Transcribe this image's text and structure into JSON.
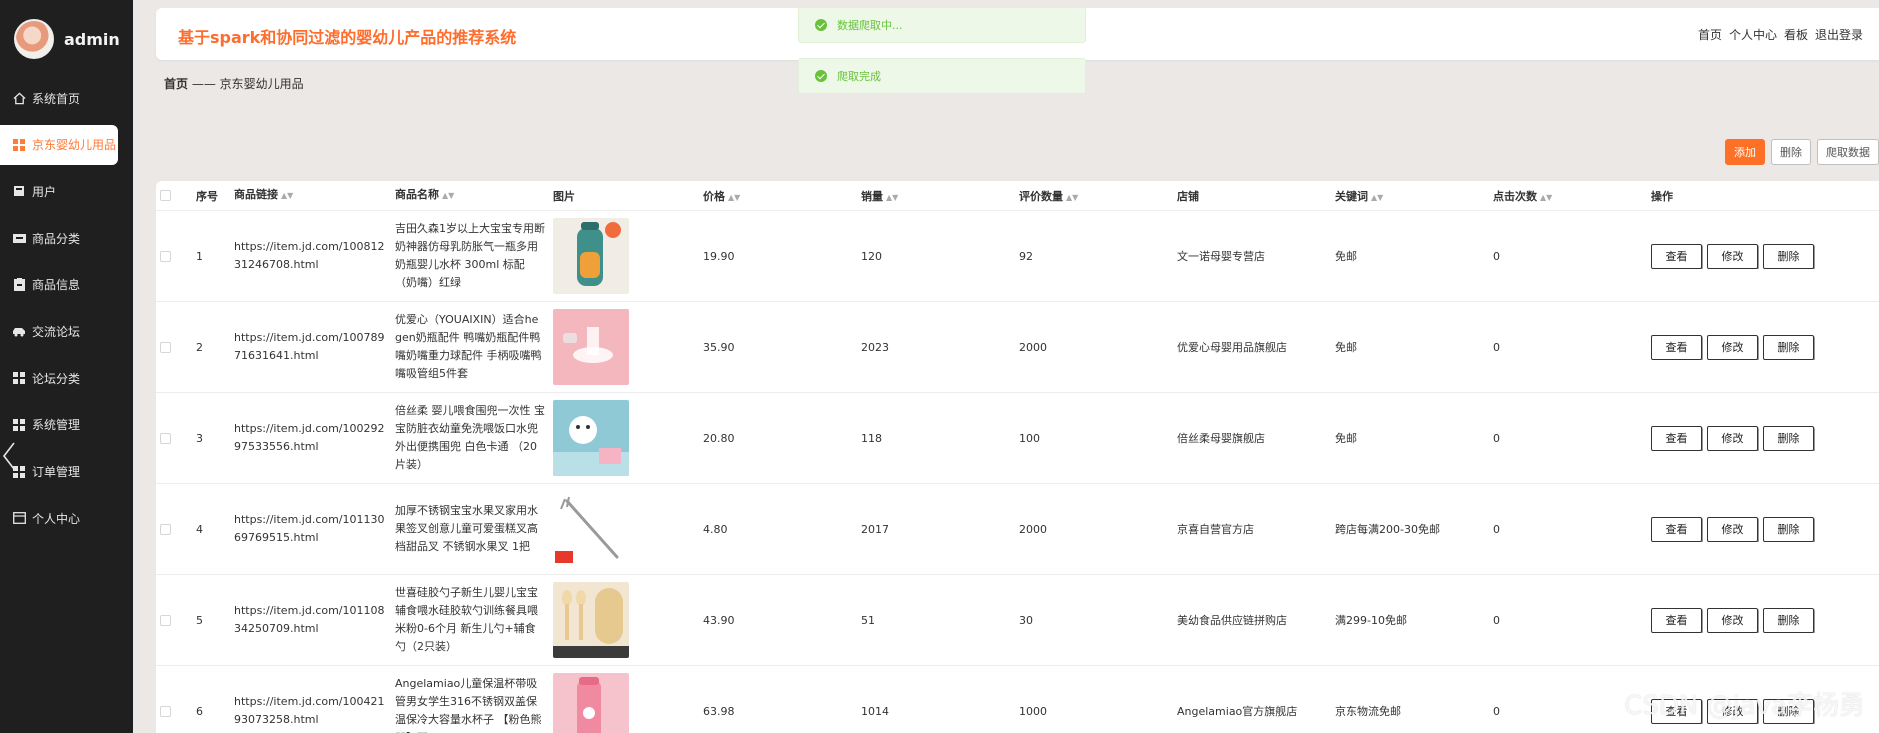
{
  "sidebar": {
    "username": "admin",
    "items": [
      {
        "label": "系统首页",
        "icon": "home-icon",
        "active": false
      },
      {
        "label": "京东婴幼儿用品",
        "icon": "grid-icon",
        "active": true
      },
      {
        "label": "用户",
        "icon": "user-icon",
        "active": false
      },
      {
        "label": "商品分类",
        "icon": "category-icon",
        "active": false
      },
      {
        "label": "商品信息",
        "icon": "clipboard-icon",
        "active": false
      },
      {
        "label": "交流论坛",
        "icon": "car-icon",
        "active": false
      },
      {
        "label": "论坛分类",
        "icon": "grid-icon",
        "active": false
      },
      {
        "label": "系统管理",
        "icon": "grid-icon",
        "active": false
      },
      {
        "label": "订单管理",
        "icon": "grid-icon",
        "active": false
      },
      {
        "label": "个人中心",
        "icon": "profile-icon",
        "active": false
      }
    ]
  },
  "header": {
    "title": "基于spark和协同过滤的婴幼儿产品的推荐系统",
    "links": [
      "首页",
      "个人中心",
      "看板",
      "退出登录"
    ]
  },
  "toasts": [
    "数据爬取中...",
    "爬取完成"
  ],
  "breadcrumb": {
    "home": "首页",
    "sep": "——",
    "current": "京东婴幼儿用品"
  },
  "actions": {
    "add": "添加",
    "delete": "删除",
    "crawl": "爬取数据"
  },
  "table": {
    "columns": [
      "序号",
      "商品链接",
      "商品名称",
      "图片",
      "价格",
      "销量",
      "评价数量",
      "店铺",
      "关键词",
      "点击次数",
      "操作"
    ],
    "op_labels": {
      "view": "查看",
      "edit": "修改",
      "delete": "删除"
    },
    "rows": [
      {
        "no": "1",
        "link": "https://item.jd.com/10081231246708.html",
        "name": "吉田久森1岁以上大宝宝专用断奶神器仿母乳防胀气一瓶多用奶瓶婴儿水杯 300ml 标配（奶嘴）红绿",
        "price": "19.90",
        "sales": "120",
        "reviews": "92",
        "shop": "文一诺母婴专营店",
        "keyword": "免邮",
        "clicks": "0"
      },
      {
        "no": "2",
        "link": "https://item.jd.com/10078971631641.html",
        "name": "优爱心（YOUAIXIN）适合hegen奶瓶配件 鸭嘴奶瓶配件鸭嘴奶嘴重力球配件 手柄吸嘴鸭嘴吸管组5件套",
        "price": "35.90",
        "sales": "2023",
        "reviews": "2000",
        "shop": "优爱心母婴用品旗舰店",
        "keyword": "免邮",
        "clicks": "0"
      },
      {
        "no": "3",
        "link": "https://item.jd.com/10029297533556.html",
        "name": "倍丝柔 婴儿喂食围兜一次性 宝宝防脏衣幼童免洗喂饭口水兜外出便携围兜 白色卡通 （20片装）",
        "price": "20.80",
        "sales": "118",
        "reviews": "100",
        "shop": "倍丝柔母婴旗舰店",
        "keyword": "免邮",
        "clicks": "0"
      },
      {
        "no": "4",
        "link": "https://item.jd.com/10113069769515.html",
        "name": "加厚不锈钢宝宝水果叉家用水果签叉创意儿童可爱蛋糕叉高档甜品叉 不锈钢水果叉 1把",
        "price": "4.80",
        "sales": "2017",
        "reviews": "2000",
        "shop": "京喜自营官方店",
        "keyword": "跨店每满200-30免邮",
        "clicks": "0"
      },
      {
        "no": "5",
        "link": "https://item.jd.com/10110834250709.html",
        "name": "世喜硅胶勺子新生儿婴儿宝宝辅食喂水硅胶软勺训练餐具喂米粉0-6个月 新生儿勺+辅食勺（2只装）",
        "price": "43.90",
        "sales": "51",
        "reviews": "30",
        "shop": "美幼食品供应链拼购店",
        "keyword": "满299-10免邮",
        "clicks": "0"
      },
      {
        "no": "6",
        "link": "https://item.jd.com/10042193073258.html",
        "name": "Angelamiao儿童保温杯带吸管男女学生316不锈钢双盖保温保冷大容量水杯子 【粉色熊凹】双",
        "price": "63.98",
        "sales": "1014",
        "reviews": "1000",
        "shop": "Angelamiao官方旗舰店",
        "keyword": "京东物流免邮",
        "clicks": "0"
      }
    ]
  },
  "watermark": "CSDN @java李杨勇"
}
